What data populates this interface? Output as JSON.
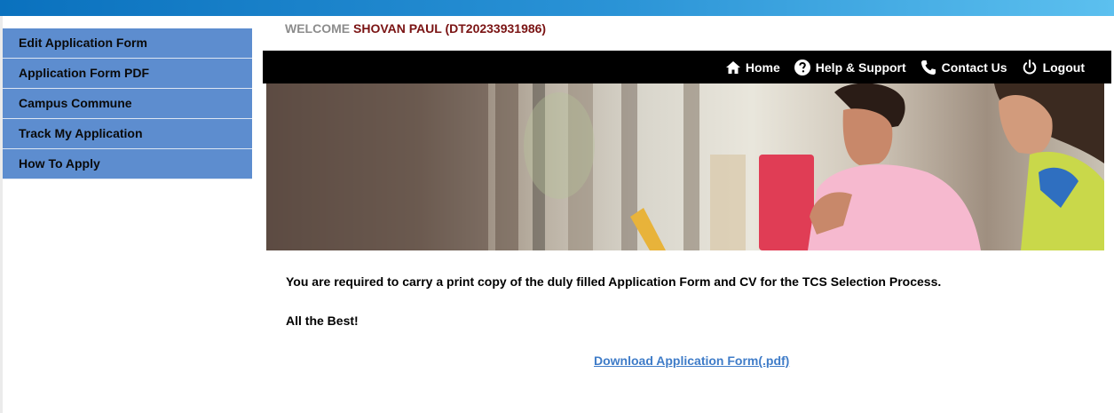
{
  "sidebar": {
    "items": [
      {
        "label": "Edit Application Form"
      },
      {
        "label": "Application Form PDF"
      },
      {
        "label": "Campus Commune"
      },
      {
        "label": "Track My Application"
      },
      {
        "label": "How To Apply"
      }
    ]
  },
  "header": {
    "welcome_label": "WELCOME",
    "user_name": "SHOVAN PAUL (DT20233931986)"
  },
  "nav": {
    "home": {
      "label": "Home",
      "icon": "home-icon"
    },
    "help": {
      "label": "Help & Support",
      "icon": "help-icon"
    },
    "contact": {
      "label": "Contact Us",
      "icon": "phone-icon"
    },
    "logout": {
      "label": "Logout",
      "icon": "power-icon"
    }
  },
  "content": {
    "notice": "You are required to carry a print copy of the duly filled Application Form and CV for the TCS Selection Process.",
    "closing": "All the Best!",
    "download_link": "Download Application Form(.pdf)"
  },
  "colors": {
    "sidebar_bg": "#5d8dcf",
    "navbar_bg": "#000000",
    "link": "#3f7cc8",
    "user_name": "#7a1313"
  }
}
